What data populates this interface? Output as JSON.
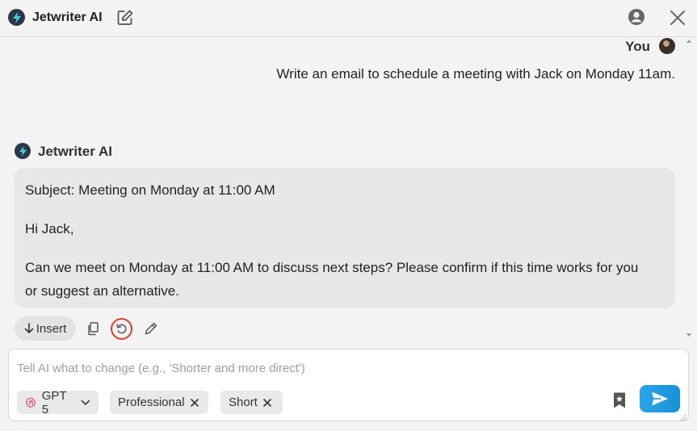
{
  "header": {
    "app_title": "Jetwriter AI",
    "icons": [
      "bolt-icon",
      "edit-icon",
      "account-icon",
      "close-icon"
    ]
  },
  "conversation": {
    "user_label": "You",
    "user_message": "Write an email to schedule a meeting with Jack on Monday 11am.",
    "assistant_name": "Jetwriter AI",
    "assistant_reply": {
      "subject_line": "Subject: Meeting on Monday at 11:00 AM",
      "greeting": "Hi Jack,",
      "body_line_1": "Can we meet on Monday at 11:00 AM to discuss next steps? Please confirm if this time works for you",
      "body_line_2": "or suggest an alternative."
    },
    "actions": {
      "insert_label": "Insert",
      "icons": [
        "copy-icon",
        "regenerate-icon",
        "pencil-icon"
      ]
    }
  },
  "composer": {
    "placeholder": "Tell AI what to change (e.g., 'Shorter and more direct')",
    "value": "",
    "model_label": "GPT 5",
    "tone_chip": "Professional",
    "length_chip": "Short"
  },
  "colors": {
    "accent_blue": "#1a8fd6",
    "highlight_red": "#e53935",
    "bubble_gray": "#e7e7e7",
    "logo_dark": "#2d3748",
    "bolt_cyan": "#3fd0e0"
  }
}
